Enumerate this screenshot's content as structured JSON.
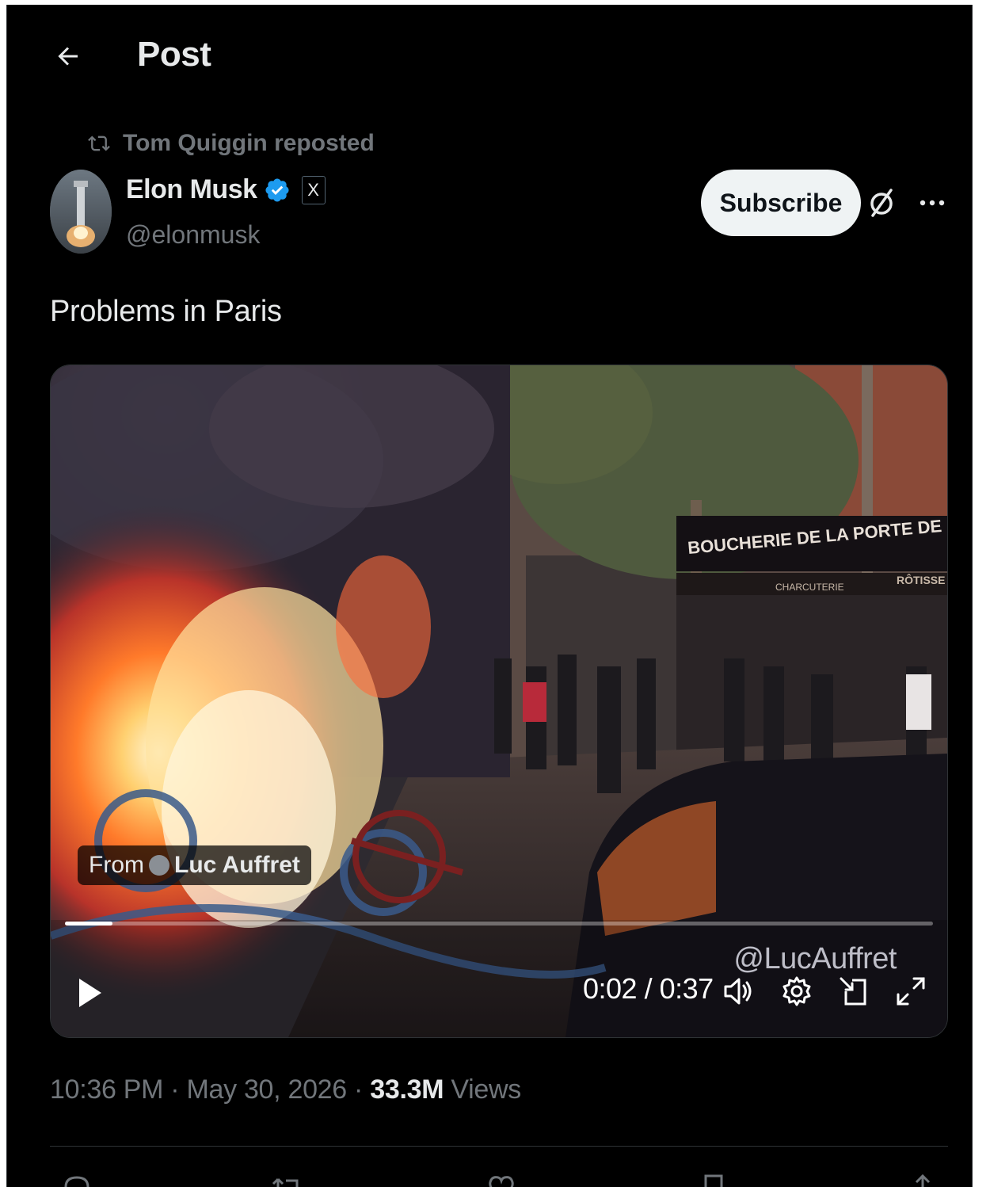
{
  "header": {
    "title": "Post"
  },
  "repost": {
    "text": "Tom Quiggin reposted"
  },
  "author": {
    "name": "Elon Musk",
    "handle": "@elonmusk",
    "verified": true,
    "affiliate_badge": "X"
  },
  "buttons": {
    "subscribe": "Subscribe"
  },
  "post": {
    "text": "Problems in Paris"
  },
  "video": {
    "from_label": "From",
    "source_name": "Luc Auffret",
    "watermark": "@LucAuffret",
    "time": "0:02 / 0:37",
    "progress": 0.055,
    "storefront_sign": "BOUCHERIE DE LA PORTE DE SAINT -",
    "storefront_sub_left": "CHARCUTERIE",
    "storefront_sub_right": "RÔTISSE"
  },
  "meta": {
    "time": "10:36 PM",
    "date": "May 30, 2026",
    "views_count": "33.3M",
    "views_label": "Views",
    "separator": " · "
  },
  "colors": {
    "background": "#000000",
    "text_primary": "#e7e9ea",
    "text_secondary": "#71767b",
    "verified_blue": "#1d9bf0",
    "divider": "#2f3336"
  },
  "icons": [
    "back-arrow-icon",
    "repost-icon",
    "verified-badge-icon",
    "grok-icon",
    "more-icon",
    "play-icon",
    "volume-icon",
    "settings-icon",
    "pip-icon",
    "fullscreen-icon",
    "reply-icon",
    "retweet-icon",
    "like-icon",
    "bookmark-icon",
    "share-icon"
  ]
}
